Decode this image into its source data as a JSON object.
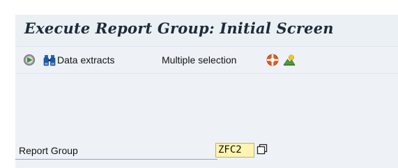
{
  "window": {
    "title": "Execute Report Group: Initial Screen"
  },
  "toolbar": {
    "execute_icon": "execute-icon",
    "data_extracts_icon": "binoculars-icon",
    "data_extracts_label": "Data extracts",
    "multiple_selection_label": "Multiple selection",
    "help_icon": "lifebuoy-icon",
    "extra_icon": "mountain-landscape-icon"
  },
  "form": {
    "report_group_label": "Report Group",
    "report_group_value": "ZFC2",
    "value_help_icon": "value-help-icon"
  },
  "colors": {
    "title_bg": "#ebf0f5",
    "window_bg": "#eef2f7",
    "input_bg": "#fff4b0",
    "title_text": "#1f2a38"
  }
}
